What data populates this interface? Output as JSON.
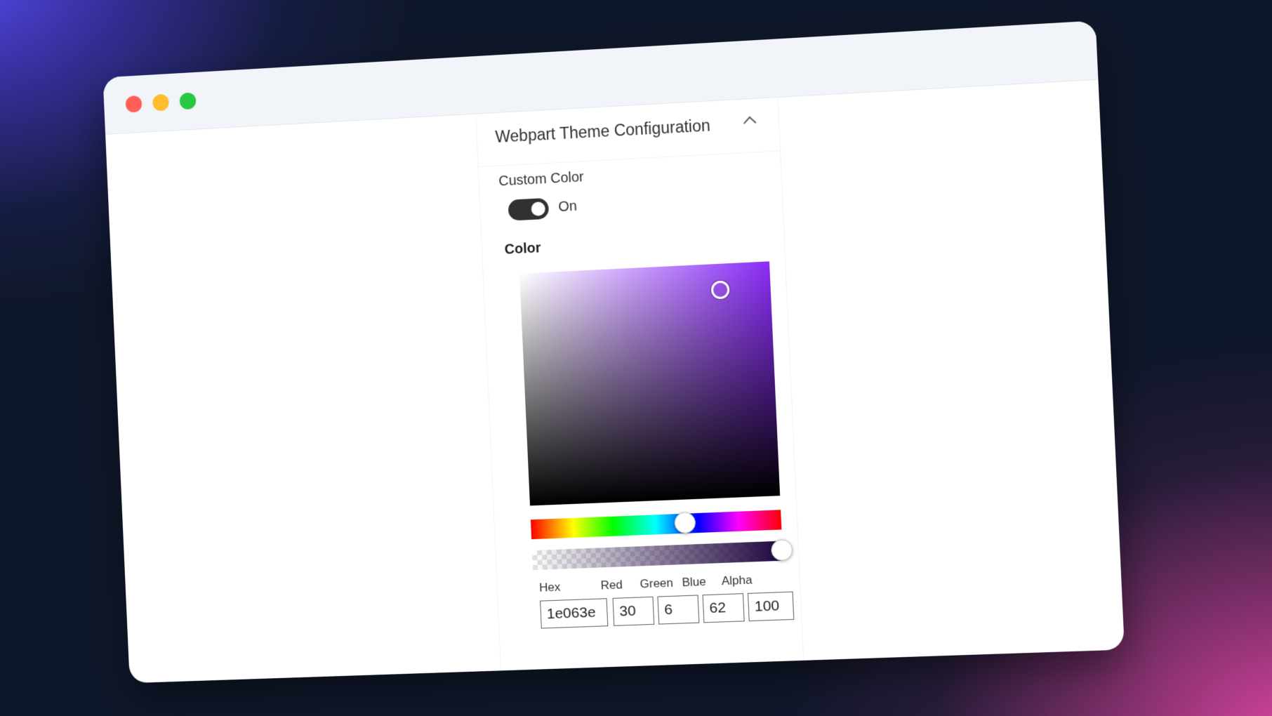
{
  "window": {
    "controls": [
      {
        "name": "close",
        "color": "#ff5f57"
      },
      {
        "name": "minimize",
        "color": "#febc2e"
      },
      {
        "name": "maximize",
        "color": "#28c840"
      }
    ]
  },
  "panel": {
    "header_title": "Webpart Theme Configuration",
    "expanded": true
  },
  "custom_color": {
    "label": "Custom Color",
    "toggle_on": true,
    "state_text": "On"
  },
  "color_picker": {
    "label": "Color",
    "hue": 267,
    "fields": {
      "hex": {
        "label": "Hex",
        "value": "1e063e"
      },
      "red": {
        "label": "Red",
        "value": "30"
      },
      "green": {
        "label": "Green",
        "value": "6"
      },
      "blue": {
        "label": "Blue",
        "value": "62"
      },
      "alpha": {
        "label": "Alpha",
        "value": "100"
      }
    }
  }
}
